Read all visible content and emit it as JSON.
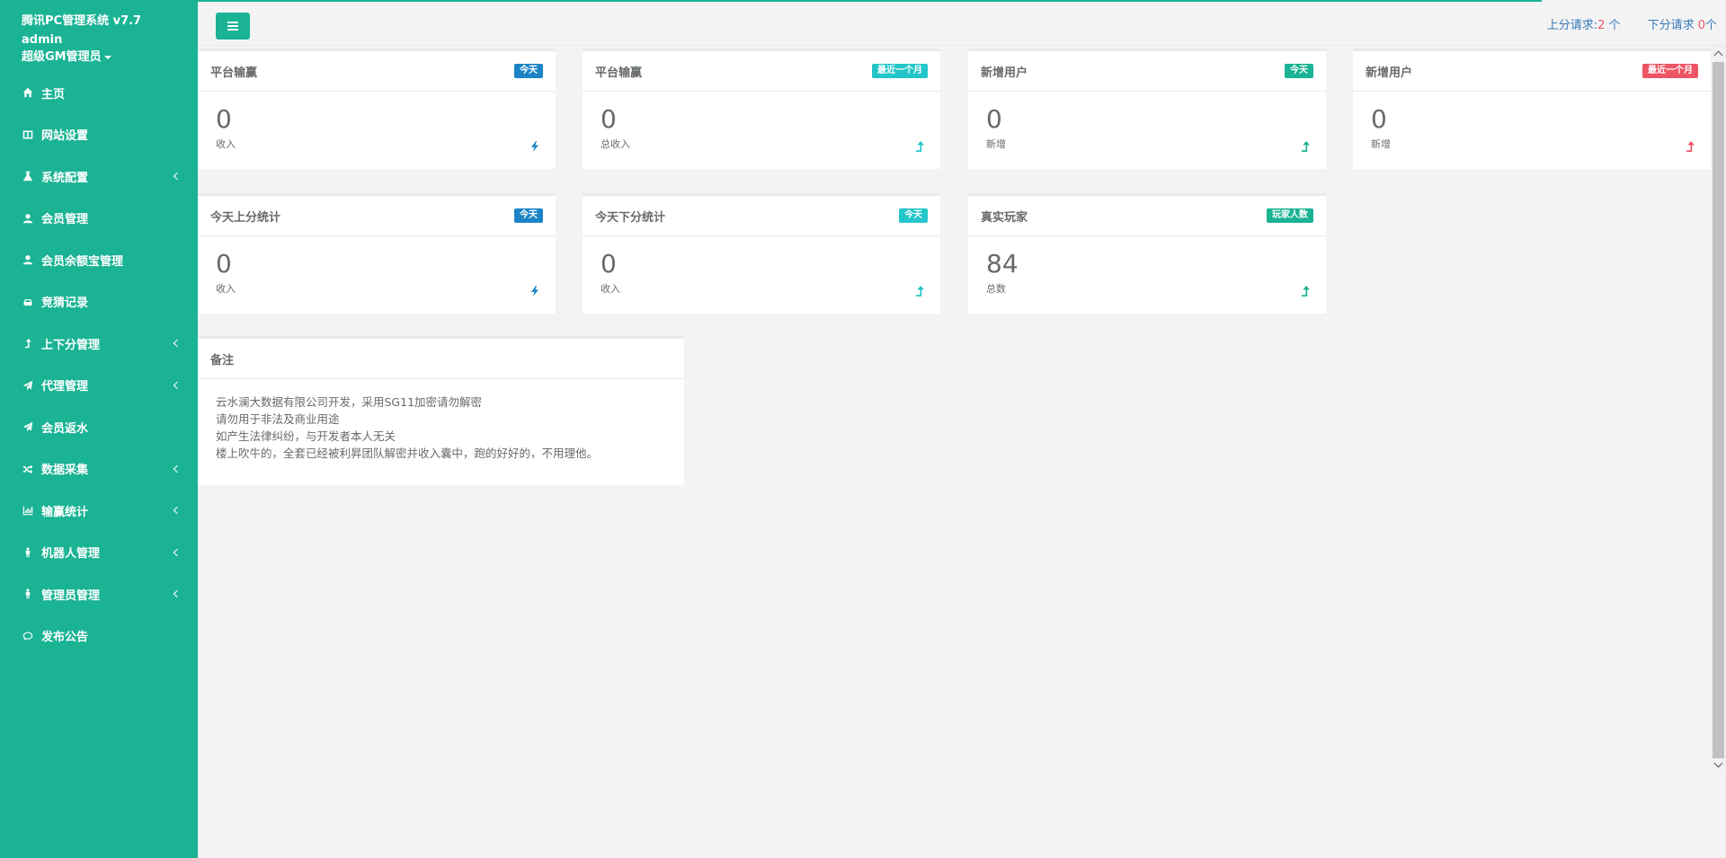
{
  "sidebar": {
    "title": "腾讯PC管理系统 v7.7",
    "username": "admin",
    "role": "超级GM管理员",
    "items": [
      {
        "label": "主页",
        "icon": "home-icon",
        "submenu": false
      },
      {
        "label": "网站设置",
        "icon": "columns-icon",
        "submenu": false
      },
      {
        "label": "系统配置",
        "icon": "flask-icon",
        "submenu": true
      },
      {
        "label": "会员管理",
        "icon": "user-icon",
        "submenu": false
      },
      {
        "label": "会员余额宝管理",
        "icon": "user-icon",
        "submenu": false
      },
      {
        "label": "竞猜记录",
        "icon": "taxi-icon",
        "submenu": false
      },
      {
        "label": "上下分管理",
        "icon": "level-up-icon",
        "submenu": true
      },
      {
        "label": "代理管理",
        "icon": "paper-plane-icon",
        "submenu": true
      },
      {
        "label": "会员返水",
        "icon": "paper-plane-icon",
        "submenu": false
      },
      {
        "label": "数据采集",
        "icon": "random-icon",
        "submenu": true
      },
      {
        "label": "输赢统计",
        "icon": "bar-chart-icon",
        "submenu": true
      },
      {
        "label": "机器人管理",
        "icon": "male-icon",
        "submenu": true
      },
      {
        "label": "管理员管理",
        "icon": "male-icon",
        "submenu": true
      },
      {
        "label": "发布公告",
        "icon": "comment-icon",
        "submenu": false
      }
    ]
  },
  "topbar": {
    "up_label": "上分请求:",
    "up_count": "2",
    "up_unit": " 个",
    "down_label": "下分请求 ",
    "down_count": "0",
    "down_unit": "个"
  },
  "cards": [
    {
      "title": "平台输赢",
      "badge": "今天",
      "badge_color": "#1c84c6",
      "value": "0",
      "sub": "收入",
      "icon": "bolt-icon",
      "icon_color": "#1c84c6"
    },
    {
      "title": "平台输赢",
      "badge": "最近一个月",
      "badge_color": "#23c6c8",
      "value": "0",
      "sub": "总收入",
      "icon": "level-up-icon",
      "icon_color": "#23c6c8"
    },
    {
      "title": "新增用户",
      "badge": "今天",
      "badge_color": "#1ab394",
      "value": "0",
      "sub": "新增",
      "icon": "level-up-icon",
      "icon_color": "#1ab394"
    },
    {
      "title": "新增用户",
      "badge": "最近一个月",
      "badge_color": "#ed5565",
      "value": "0",
      "sub": "新增",
      "icon": "level-up-icon",
      "icon_color": "#ed5565"
    },
    {
      "title": "今天上分统计",
      "badge": "今天",
      "badge_color": "#1c84c6",
      "value": "0",
      "sub": "收入",
      "icon": "bolt-icon",
      "icon_color": "#1c84c6"
    },
    {
      "title": "今天下分统计",
      "badge": "今天",
      "badge_color": "#23c6c8",
      "value": "0",
      "sub": "收入",
      "icon": "level-up-icon",
      "icon_color": "#23c6c8"
    },
    {
      "title": "真实玩家",
      "badge": "玩家人数",
      "badge_color": "#1ab394",
      "value": "84",
      "sub": "总数",
      "icon": "level-up-icon",
      "icon_color": "#1ab394"
    }
  ],
  "notes": {
    "title": "备注",
    "lines": [
      "云水澜大数据有限公司开发，采用SG11加密请勿解密",
      "请勿用于非法及商业用途",
      "如产生法律纠纷，与开发者本人无关",
      "楼上吹牛的，全套已经被利昇团队解密并收入囊中，跑的好好的，不用理他。"
    ]
  }
}
